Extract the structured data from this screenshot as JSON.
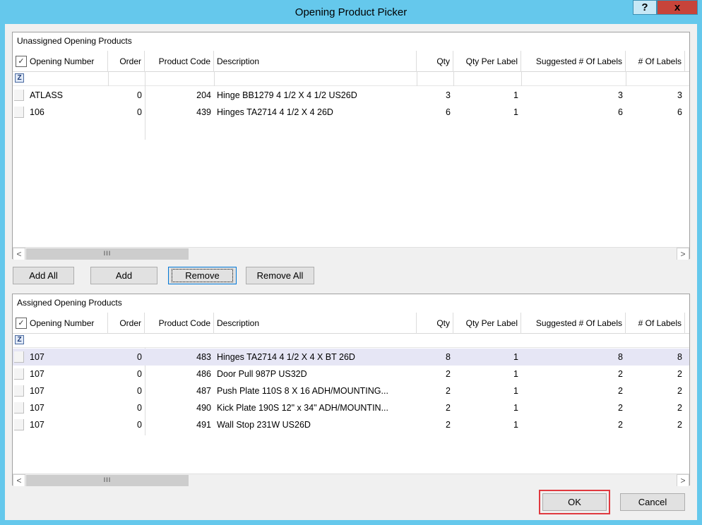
{
  "window": {
    "title": "Opening Product Picker",
    "help_label": "?",
    "close_label": "x"
  },
  "columns": {
    "check_glyph": "✓",
    "opening_number": "Opening Number",
    "order": "Order",
    "product_code": "Product Code",
    "description": "Description",
    "qty": "Qty",
    "qty_per_label": "Qty Per Label",
    "suggested_labels": "Suggested # Of Labels",
    "num_labels": "# Of Labels"
  },
  "unassigned": {
    "title": "Unassigned Opening Products",
    "rows": [
      {
        "opening": "ATLASS",
        "order": "0",
        "code": "204",
        "description": "Hinge BB1279 4 1/2 X 4 1/2 US26D",
        "qty": "3",
        "qty_per_label": "1",
        "suggested": "3",
        "labels": "3"
      },
      {
        "opening": "106",
        "order": "0",
        "code": "439",
        "description": "Hinges TA2714 4 1/2 X 4 26D",
        "qty": "6",
        "qty_per_label": "1",
        "suggested": "6",
        "labels": "6"
      }
    ]
  },
  "assigned": {
    "title": "Assigned Opening Products",
    "rows": [
      {
        "opening": "107",
        "order": "0",
        "code": "483",
        "description": "Hinges TA2714 4 1/2 X 4 X BT 26D",
        "qty": "8",
        "qty_per_label": "1",
        "suggested": "8",
        "labels": "8"
      },
      {
        "opening": "107",
        "order": "0",
        "code": "486",
        "description": "Door Pull 987P US32D",
        "qty": "2",
        "qty_per_label": "1",
        "suggested": "2",
        "labels": "2"
      },
      {
        "opening": "107",
        "order": "0",
        "code": "487",
        "description": "Push Plate 110S 8 X 16 ADH/MOUNTING...",
        "qty": "2",
        "qty_per_label": "1",
        "suggested": "2",
        "labels": "2"
      },
      {
        "opening": "107",
        "order": "0",
        "code": "490",
        "description": "Kick Plate 190S 12\" x 34\" ADH/MOUNTIN...",
        "qty": "2",
        "qty_per_label": "1",
        "suggested": "2",
        "labels": "2"
      },
      {
        "opening": "107",
        "order": "0",
        "code": "491",
        "description": "Wall Stop 231W US26D",
        "qty": "2",
        "qty_per_label": "1",
        "suggested": "2",
        "labels": "2"
      }
    ]
  },
  "scrollbar": {
    "left_arrow": "<",
    "right_arrow": ">",
    "thumb_grip": "III"
  },
  "filter_glyph": "Z",
  "buttons": {
    "add_all": "Add All",
    "add": "Add",
    "remove": "Remove",
    "remove_all": "Remove All",
    "ok": "OK",
    "cancel": "Cancel"
  },
  "colors": {
    "title_bar": "#65c8ec",
    "close_button": "#c7443a",
    "selected_row": "#e6e6f5",
    "ok_highlight": "#e0393f"
  }
}
